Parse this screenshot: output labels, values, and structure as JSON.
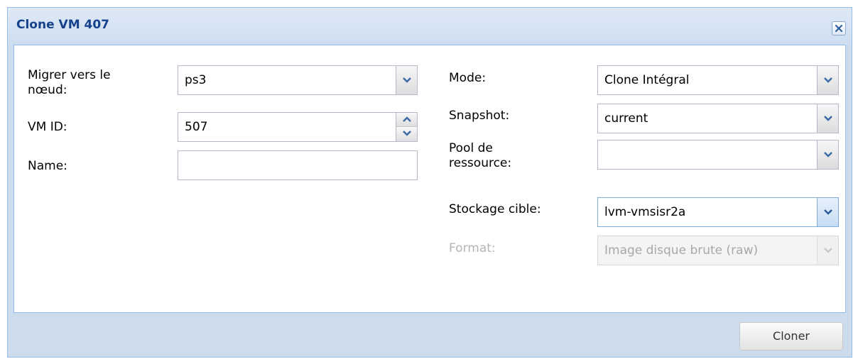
{
  "window": {
    "title": "Clone VM 407"
  },
  "form_left": {
    "target_node": {
      "label": "Migrer vers le\nnœud:",
      "value": "ps3"
    },
    "vm_id": {
      "label": "VM ID:",
      "value": "507"
    },
    "name": {
      "label": "Name:",
      "value": ""
    }
  },
  "form_right": {
    "mode": {
      "label": "Mode:",
      "value": "Clone Intégral"
    },
    "snapshot": {
      "label": "Snapshot:",
      "value": "current"
    },
    "resource_pool": {
      "label": "Pool de\nressource:",
      "value": ""
    },
    "target_storage": {
      "label": "Stockage cible:",
      "value": "lvm-vmsisr2a"
    },
    "format": {
      "label": "Format:",
      "value": "Image disque brute (raw)"
    }
  },
  "footer": {
    "clone_button": "Cloner"
  },
  "icons": {
    "close": "close-icon",
    "dropdown": "chevron-down-icon",
    "spin_up": "chevron-up-icon",
    "spin_down": "chevron-down-icon"
  },
  "colors": {
    "title": "#15428b",
    "window_bg": "#cddcec",
    "border": "#99bbe8",
    "disabled_text": "#b4b4b4"
  }
}
